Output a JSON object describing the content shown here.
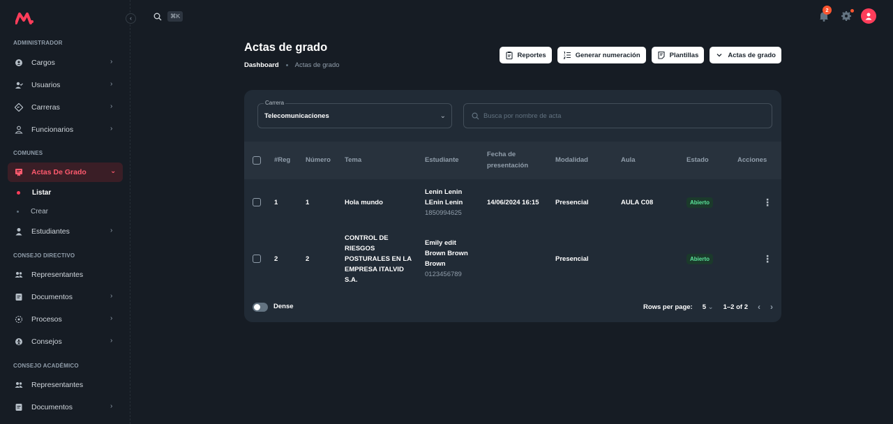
{
  "colors": {
    "accent": "#ff3d5a",
    "background": "#161c24",
    "card": "#212b36",
    "success": "#5be49b"
  },
  "topbar": {
    "search_shortcut": "⌘K",
    "notification_count": "2"
  },
  "sidebar": {
    "sections": [
      {
        "title": "ADMINISTRADOR"
      },
      {
        "title": "COMUNES"
      },
      {
        "title": "CONSEJO DIRECTIVO"
      },
      {
        "title": "CONSEJO ACADÉMICO"
      }
    ],
    "items": [
      {
        "label": "Cargos",
        "icon": "badge-icon"
      },
      {
        "label": "Usuarios",
        "icon": "user-check-icon"
      },
      {
        "label": "Carreras",
        "icon": "route-icon"
      },
      {
        "label": "Funcionarios",
        "icon": "person-icon"
      },
      {
        "label": "Actas De Grado",
        "icon": "certificate-icon"
      },
      {
        "label": "Estudiantes",
        "icon": "student-icon"
      },
      {
        "label": "Representantes",
        "icon": "users-icon"
      },
      {
        "label": "Documentos",
        "icon": "document-icon"
      },
      {
        "label": "Procesos",
        "icon": "process-icon"
      },
      {
        "label": "Consejos",
        "icon": "council-icon"
      },
      {
        "label": "Representantes",
        "icon": "users-icon"
      },
      {
        "label": "Documentos",
        "icon": "document-icon"
      }
    ],
    "subitems": [
      {
        "label": "Listar"
      },
      {
        "label": "Crear"
      }
    ]
  },
  "header": {
    "title": "Actas de grado",
    "breadcrumb": {
      "root": "Dashboard",
      "current": "Actas de grado"
    },
    "actions": [
      {
        "label": "Reportes",
        "icon": "clipboard-icon"
      },
      {
        "label": "Generar numeración",
        "icon": "list-numbered-icon"
      },
      {
        "label": "Plantillas",
        "icon": "template-icon"
      },
      {
        "label": "Actas de grado",
        "icon": "chevron-down-icon"
      }
    ]
  },
  "filters": {
    "carrera_label": "Carrera",
    "carrera_value": "Telecomunicaciones",
    "search_placeholder": "Busca por nombre de acta"
  },
  "table": {
    "headers": {
      "reg": "#Reg",
      "numero": "Número",
      "tema": "Tema",
      "estudiante": "Estudiante",
      "fecha_1": "Fecha de",
      "fecha_2": "presentación",
      "modalidad": "Modalidad",
      "aula": "Aula",
      "estado": "Estado",
      "acciones": "Acciones"
    },
    "rows": [
      {
        "reg": "1",
        "numero": "1",
        "tema": [
          "Hola mundo"
        ],
        "estudiante": [
          "Lenin Lenin",
          "LEnin Lenin"
        ],
        "cedula": "1850994625",
        "fecha": "14/06/2024 16:15",
        "modalidad": "Presencial",
        "aula": "AULA C08",
        "estado": "Abierto"
      },
      {
        "reg": "2",
        "numero": "2",
        "tema": [
          "CONTROL DE",
          "RIESGOS",
          "POSTURALES EN LA",
          "EMPRESA ITALVID",
          "S.A."
        ],
        "estudiante": [
          "Emily edit",
          "Brown Brown",
          "Brown"
        ],
        "cedula": "0123456789",
        "fecha": "",
        "modalidad": "Presencial",
        "aula": "",
        "estado": "Abierto"
      }
    ]
  },
  "footer": {
    "dense_label": "Dense",
    "rows_per_page_label": "Rows per page:",
    "rows_per_page": "5",
    "range": "1–2 of 2"
  }
}
